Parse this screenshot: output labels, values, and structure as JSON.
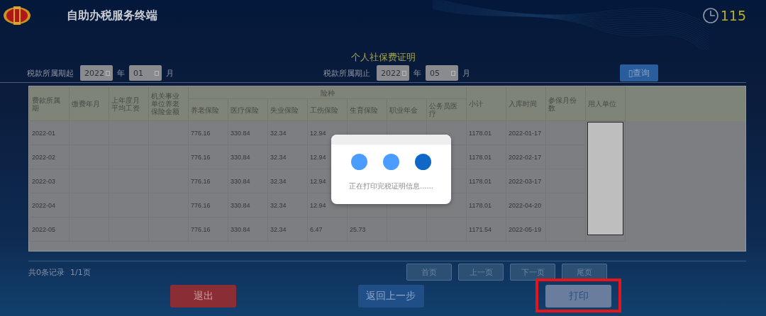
{
  "header": {
    "title": "自助办税服务终端",
    "countdown": "115"
  },
  "page_title": "个人社保费证明",
  "filters": [
    {
      "label": "税款所属期起",
      "year": "2022",
      "year_unit": "年",
      "month": "01",
      "month_unit": "月"
    },
    {
      "label": "税款所属期止",
      "year": "2022",
      "year_unit": "年",
      "month": "05",
      "month_unit": "月"
    }
  ],
  "query_button": {
    "icon": "▯",
    "label": "查询"
  },
  "table": {
    "group_header": "险种",
    "columns": [
      {
        "label": "费款所属期",
        "in_group": false,
        "kind": "text"
      },
      {
        "label": "缴费年月",
        "in_group": false,
        "kind": "text"
      },
      {
        "label": "上年度月平均工资",
        "in_group": false,
        "kind": "text"
      },
      {
        "label": "机关事业单位养老保险金额",
        "in_group": false,
        "kind": "text"
      },
      {
        "label": "养老保险",
        "in_group": true,
        "kind": "text"
      },
      {
        "label": "医疗保险",
        "in_group": true,
        "kind": "text"
      },
      {
        "label": "失业保险",
        "in_group": true,
        "kind": "text"
      },
      {
        "label": "工伤保险",
        "in_group": true,
        "kind": "text"
      },
      {
        "label": "生育保险",
        "in_group": true,
        "kind": "text"
      },
      {
        "label": "职业年金",
        "in_group": true,
        "kind": "text"
      },
      {
        "label": "公务员医疗",
        "in_group": true,
        "kind": "text"
      },
      {
        "label": "小计",
        "in_group": false,
        "kind": "text"
      },
      {
        "label": "入库时间",
        "in_group": false,
        "kind": "text"
      },
      {
        "label": "参保月份数",
        "in_group": false,
        "kind": "text"
      },
      {
        "label": "用人单位",
        "in_group": false,
        "kind": "redacted"
      }
    ],
    "rows": [
      {
        "cells": [
          "2022-01",
          null,
          null,
          null,
          "776.16",
          "330.84",
          "32.34",
          "12.94",
          null,
          null,
          null,
          "1178.01",
          "2022-01-17",
          null
        ]
      },
      {
        "cells": [
          "2022-02",
          null,
          null,
          null,
          "776.16",
          "330.84",
          "32.34",
          "12.94",
          null,
          null,
          null,
          "1178.01",
          "2022-02-17",
          null
        ]
      },
      {
        "cells": [
          "2022-03",
          null,
          null,
          null,
          "776.16",
          "330.84",
          "32.34",
          "12.94",
          null,
          null,
          null,
          "1178.01",
          "2022-03-17",
          null
        ]
      },
      {
        "cells": [
          "2022-04",
          null,
          null,
          null,
          "776.16",
          "330.84",
          "32.34",
          "12.94",
          null,
          null,
          null,
          "1178.01",
          "2022-04-20",
          null
        ]
      },
      {
        "cells": [
          "2022-05",
          null,
          null,
          null,
          "776.16",
          "330.84",
          "32.34",
          "6.47",
          "25.73",
          null,
          null,
          "1171.54",
          "2022-05-19",
          null
        ]
      }
    ]
  },
  "pager": {
    "summary": "共0条记录",
    "pages": "1/1页",
    "buttons": [
      "首页",
      "上一页",
      "下一页",
      "尾页"
    ]
  },
  "actions": [
    {
      "label": "退出",
      "kind": "danger",
      "highlighted": false
    },
    {
      "label": "返回上一步",
      "kind": "secondary",
      "highlighted": false
    },
    {
      "label": "打印",
      "kind": "primary",
      "highlighted": true
    }
  ],
  "dialog": {
    "message": "正在打印完税证明信息......",
    "dots": [
      {
        "color": "#4a9dff"
      },
      {
        "color": "#4a9dff"
      },
      {
        "color": "#0f67c8"
      }
    ]
  }
}
